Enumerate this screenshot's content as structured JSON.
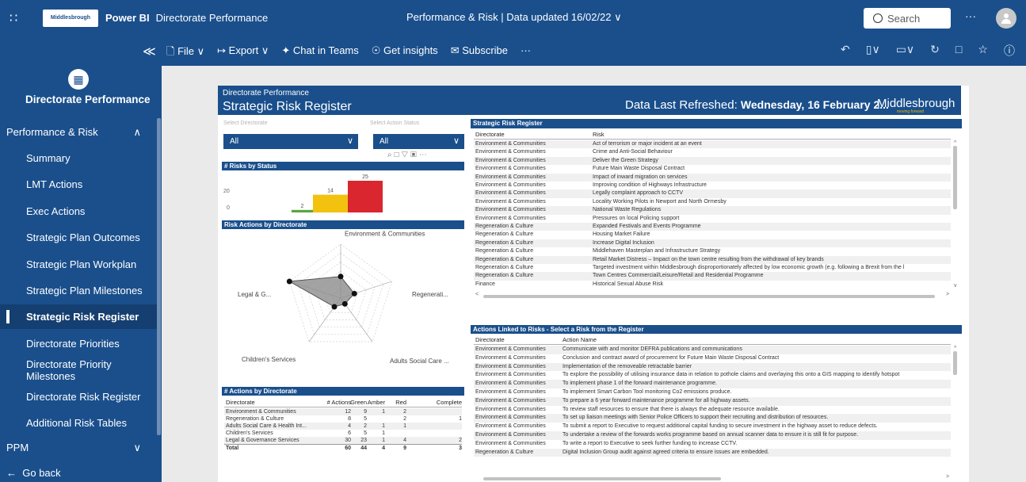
{
  "topbar": {
    "org_logo": "Middlesbrough",
    "app": "Power BI",
    "workspace": "Directorate Performance",
    "report_name": "Performance & Risk",
    "separator": "|",
    "data_updated": "Data updated 16/02/22",
    "chevron": "∨",
    "search_placeholder": "Search",
    "more": "···"
  },
  "toolbar": {
    "collapse": "≪",
    "file": "File ∨",
    "export": "Export ∨",
    "chat": "Chat in Teams",
    "insights": "Get insights",
    "subscribe": "Subscribe",
    "more": "···"
  },
  "sidebar": {
    "report_title": "Directorate Performance",
    "group": "Performance & Risk",
    "items": [
      {
        "label": "Summary"
      },
      {
        "label": "LMT Actions"
      },
      {
        "label": "Exec Actions"
      },
      {
        "label": "Strategic Plan Outcomes"
      },
      {
        "label": "Strategic Plan Workplan"
      },
      {
        "label": "Strategic Plan Milestones"
      },
      {
        "label": "Strategic Risk Register"
      },
      {
        "label": "Directorate Priorities"
      },
      {
        "label": "Directorate Priority Milestones"
      },
      {
        "label": "Directorate Risk Register"
      },
      {
        "label": "Additional Risk Tables"
      }
    ],
    "active_index": 6,
    "ppm": "PPM",
    "go_back": "Go back"
  },
  "report": {
    "header_sub": "Directorate Performance",
    "header_title": "Strategic Risk Register",
    "refresh_label": "Data Last Refreshed:",
    "refresh_value": "Wednesday, 16 February 2...",
    "logo": "Middlesbrough",
    "logo_sub": "moving forward",
    "slicer1_label": "Select Directorate",
    "slicer1_value": "All",
    "slicer2_label": "Select Action Status",
    "slicer2_value": "All"
  },
  "risks_by_status": {
    "title": "# Risks by Status",
    "y_ticks": [
      "20",
      "0"
    ],
    "chart_data": {
      "type": "bar",
      "categories": [
        "Green",
        "Amber",
        "Red"
      ],
      "values": [
        2,
        14,
        25
      ],
      "colors": [
        "#5aa63f",
        "#f2c20f",
        "#d9262f"
      ],
      "ylim": [
        0,
        25
      ]
    }
  },
  "radar": {
    "title": "Risk Actions by Directorate",
    "chart_data": {
      "type": "radar",
      "categories": [
        "Environment & Communities",
        "Regenerati...",
        "Adults Social Care ...",
        "Children's Services",
        "Legal & G..."
      ],
      "values": [
        12,
        8,
        4,
        6,
        30
      ],
      "max": 30
    }
  },
  "actions_table": {
    "title": "# Actions by Directorate",
    "headers": [
      "Directorate",
      "# Actions",
      "Green",
      "Amber",
      "Red",
      "Complete"
    ],
    "rows": [
      [
        "Environment & Communities",
        "12",
        "9",
        "1",
        "2",
        ""
      ],
      [
        "Regeneration & Culture",
        "8",
        "5",
        "",
        "2",
        "1"
      ],
      [
        "Adults Social Care & Health Int...",
        "4",
        "2",
        "1",
        "1",
        ""
      ],
      [
        "Children's Services",
        "6",
        "5",
        "1",
        "",
        ""
      ],
      [
        "Legal & Governance Services",
        "30",
        "23",
        "1",
        "4",
        "2"
      ]
    ],
    "total": [
      "Total",
      "60",
      "44",
      "4",
      "9",
      "3"
    ]
  },
  "risk_register": {
    "title": "Strategic Risk Register",
    "headers": [
      "Directorate",
      "Risk"
    ],
    "rows": [
      [
        "Environment & Communities",
        "Act of terrorism or major incident at an event"
      ],
      [
        "Environment & Communities",
        "Crime and Anti-Social Behaviour"
      ],
      [
        "Environment & Communities",
        "Deliver the Green Strategy"
      ],
      [
        "Environment & Communities",
        "Future Main Waste Disposal Contract"
      ],
      [
        "Environment & Communities",
        "Impact of inward migration on services"
      ],
      [
        "Environment & Communities",
        "Improving condition of Highways Infrastructure"
      ],
      [
        "Environment & Communities",
        "Legally complaint approach to CCTV"
      ],
      [
        "Environment & Communities",
        "Locality Working Pilots in Newport and North Ormesby"
      ],
      [
        "Environment & Communities",
        "National Waste Regulations"
      ],
      [
        "Environment & Communities",
        "Pressures on local Policing support"
      ],
      [
        "Regeneration & Culture",
        "Expanded Festivals and Events Programme"
      ],
      [
        "Regeneration & Culture",
        "Housing Market Failure"
      ],
      [
        "Regeneration & Culture",
        "Increase Digital Inclusion"
      ],
      [
        "Regeneration & Culture",
        "Middlehaven Masterplan and Infrastructure Strategy"
      ],
      [
        "Regeneration & Culture",
        "Retail Market Distress – Impact on the town centre resulting from the withdrawal of key brands"
      ],
      [
        "Regeneration & Culture",
        "Targeted investment within Middlesbrough disproportionately affected by low economic growth (e.g. following a Brexit from the l"
      ],
      [
        "Regeneration & Culture",
        "Town Centres Commercial/Leisure/Retail and Residential Programme"
      ],
      [
        "Finance",
        "Historical Sexual Abuse Risk"
      ]
    ]
  },
  "linked_actions": {
    "title": "Actions Linked to Risks - Select a Risk from the Register",
    "headers": [
      "Directorate",
      "Action Name"
    ],
    "rows": [
      [
        "Environment & Communities",
        "Communicate with and monitor DEFRA publications and communications"
      ],
      [
        "Environment & Communities",
        "Conclusion and contract award of procurement for Future Main Waste Disposal Contract"
      ],
      [
        "Environment & Communities",
        "Implementation of the removeable retractable barrier"
      ],
      [
        "Environment & Communities",
        "To explore the possibility of utilising insurance data in relation to pothole claims and overlaying this onto a GIS mapping to identify hotspot"
      ],
      [
        "Environment & Communities",
        "To implement phase 1 of the forward maintenance programme."
      ],
      [
        "Environment & Communities",
        "To implement Smart Carbon Tool monitoring Co2 emissions produce."
      ],
      [
        "Environment & Communities",
        "To prepare a 6 year forward maintenance programme for all highway assets."
      ],
      [
        "Environment & Communities",
        "To review staff resources to ensure that there is always the adequate resource available."
      ],
      [
        "Environment & Communities",
        "To set up liaison meetings with Senior Police Officers to support their recruiting and distribution of resources."
      ],
      [
        "Environment & Communities",
        "To submit a report to Executive to request additional capital funding to secure investment in the highway asset to reduce defects."
      ],
      [
        "Environment & Communities",
        "To undertake a review of the forwards works programme based on annual scanner data to ensure it is still fit for purpose."
      ],
      [
        "Environment & Communities",
        "To write a report to Executive to seek further funding to increase CCTV."
      ],
      [
        "Regeneration & Culture",
        "Digital Inclusion Group audit against agreed criteria to ensure issues are embedded."
      ]
    ]
  }
}
